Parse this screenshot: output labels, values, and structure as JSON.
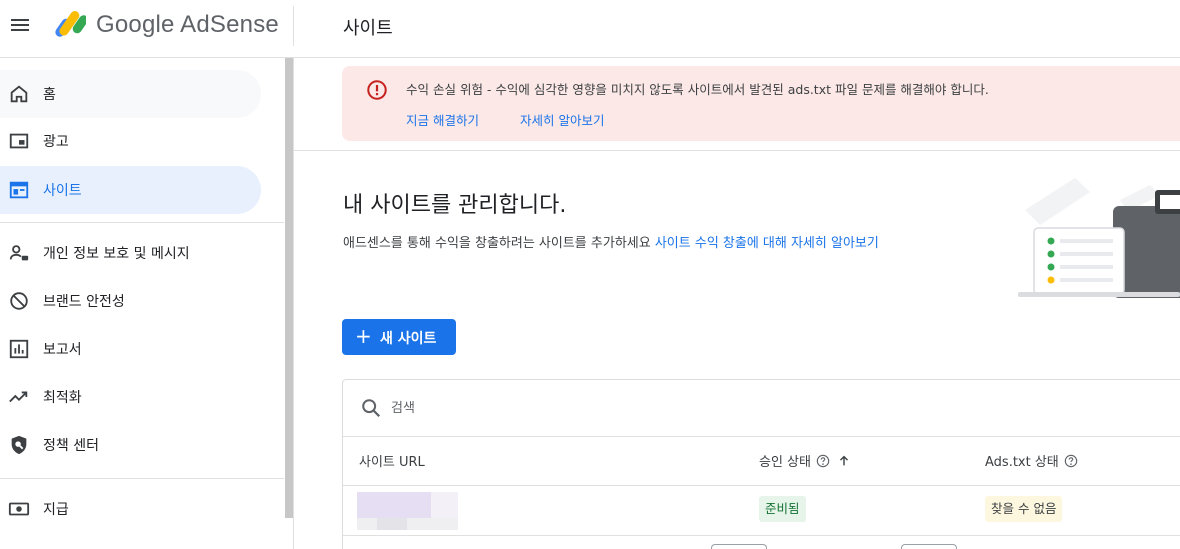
{
  "app": {
    "brand": "Google AdSense",
    "page_title": "사이트"
  },
  "sidebar": {
    "items": [
      {
        "label": "홈",
        "icon": "home-icon"
      },
      {
        "label": "광고",
        "icon": "ads-icon"
      },
      {
        "label": "사이트",
        "icon": "sites-icon",
        "active": true
      },
      {
        "label": "개인 정보 보호 및 메시지",
        "icon": "privacy-messaging-icon"
      },
      {
        "label": "브랜드 안전성",
        "icon": "brand-safety-icon"
      },
      {
        "label": "보고서",
        "icon": "reports-icon"
      },
      {
        "label": "최적화",
        "icon": "optimization-icon"
      },
      {
        "label": "정책 센터",
        "icon": "policy-center-icon"
      },
      {
        "label": "지급",
        "icon": "payments-icon"
      }
    ]
  },
  "alert": {
    "icon": "error-icon",
    "message": "수익 손실 위험 - 수익에 심각한 영향을 미치지 않도록 사이트에서 발견된 ads.txt 파일 문제를 해결해야 합니다.",
    "fix_now": "지금 해결하기",
    "learn_more": "자세히 알아보기"
  },
  "main": {
    "heading": "내 사이트를 관리합니다.",
    "subtext": "애드센스를 통해 수익을 창출하려는 사이트를 추가하세요",
    "subtext_link": "사이트 수익 창출에 대해 자세히 알아보기",
    "new_site_button": "새 사이트"
  },
  "table": {
    "search_placeholder": "검색",
    "columns": {
      "site_url": "사이트 URL",
      "approval_status": "승인 상태",
      "ads_txt_status": "Ads.txt 상태"
    },
    "rows": [
      {
        "approval_status": "준비됨",
        "ads_txt_status": "찾을 수 없음"
      }
    ]
  },
  "colors": {
    "accent": "#1a73e8",
    "alert_bg": "#fce8e6",
    "alert_icon": "#c5221f",
    "ready_bg": "#e6f4ea",
    "notfound_bg": "#fef7e0"
  }
}
